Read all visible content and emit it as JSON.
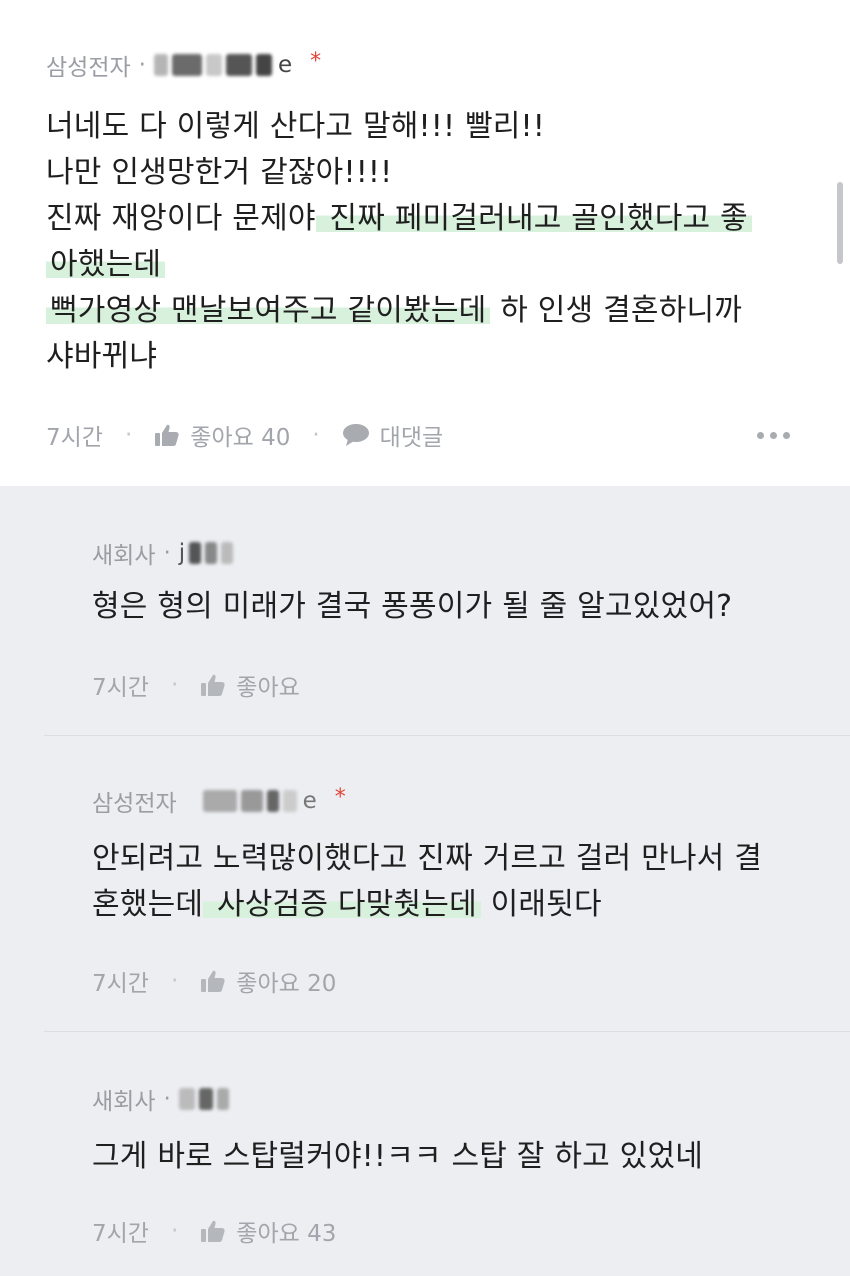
{
  "main_comment": {
    "company": "삼성전자",
    "username": "e",
    "verified_mark": "*",
    "lines": [
      {
        "segments": [
          {
            "text": "너네도 다 이렇게 산다고 말해!!! 빨리!!",
            "hl": false
          }
        ]
      },
      {
        "segments": [
          {
            "text": "나만 인생망한거 같잖아!!!!",
            "hl": false
          }
        ]
      },
      {
        "segments": [
          {
            "text": "진짜 재앙이다 문제야",
            "hl": false
          },
          {
            "text": " 진짜 페미걸러내고 골인했다고 좋",
            "hl": true
          }
        ]
      },
      {
        "segments": [
          {
            "text": "아했는데",
            "hl": true
          }
        ]
      },
      {
        "segments": [
          {
            "text": "뻑가영상 맨날보여주고 같이봤는데",
            "hl": true
          },
          {
            "text": " 하 인생 결혼하니까",
            "hl": false
          }
        ]
      },
      {
        "segments": [
          {
            "text": "샤바뀌냐",
            "hl": false
          }
        ]
      }
    ],
    "time": "7시간",
    "like_label": "좋아요 40",
    "reply_label": "대댓글"
  },
  "replies": [
    {
      "company": "새회사",
      "username": "j",
      "verified_mark": "",
      "lines": [
        {
          "segments": [
            {
              "text": "형은 형의 미래가 결국 퐁퐁이가 될 줄 알고있었어?",
              "hl": false
            }
          ]
        }
      ],
      "time": "7시간",
      "like_label": "좋아요"
    },
    {
      "company": "삼성전자",
      "username": "e",
      "verified_mark": "*",
      "lines": [
        {
          "segments": [
            {
              "text": "안되려고 노력많이했다고 진짜 거르고 걸러 만나서 결",
              "hl": false
            }
          ]
        },
        {
          "segments": [
            {
              "text": "혼했는데",
              "hl": false
            },
            {
              "text": " 사상검증 다맞췃는데",
              "hl": true
            },
            {
              "text": " 이래됫다",
              "hl": false
            }
          ]
        }
      ],
      "time": "7시간",
      "like_label": "좋아요 20"
    },
    {
      "company": "새회사",
      "username": "",
      "verified_mark": "",
      "lines": [
        {
          "segments": [
            {
              "text": "그게 바로 스탑럴커야!!ㅋㅋ 스탑 잘 하고 있었네",
              "hl": false
            }
          ]
        }
      ],
      "time": "7시간",
      "like_label": "좋아요 43"
    }
  ],
  "colors": {
    "highlight": "#d8f1dc",
    "reply_background": "#eceef2",
    "verified_star": "#e5453a",
    "meta_text": "#9a9da3"
  },
  "icons": [
    "thumbs-up-icon",
    "speech-bubble-icon",
    "more-dots-icon"
  ]
}
